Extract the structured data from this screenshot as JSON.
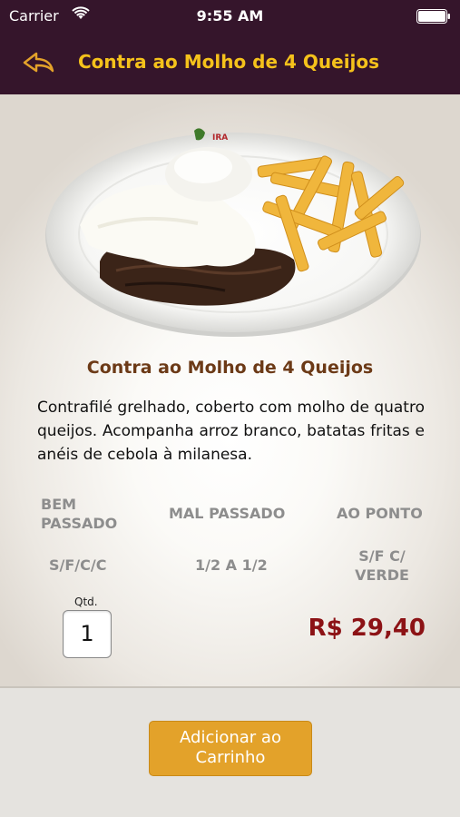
{
  "status_bar": {
    "carrier": "Carrier",
    "time": "9:55 AM"
  },
  "nav": {
    "back_icon": "back-arrow-icon",
    "title": "Contra ao Molho de  4 Queijos"
  },
  "product": {
    "image_icon": "dish-photo",
    "plate_logo": "IRA",
    "title": "Contra ao Molho de  4 Queijos",
    "description": "Contrafilé grelhado, coberto com molho de quatro queijos. Acompanha arroz branco, batatas fritas e anéis de cebola à milanesa."
  },
  "options": {
    "row1": [
      {
        "line1": "BEM",
        "line2": "PASSADO"
      },
      {
        "label": "MAL PASSADO"
      },
      {
        "label": "AO PONTO"
      }
    ],
    "row2": [
      {
        "label": "S/F/C/C"
      },
      {
        "label": "1/2 A 1/2"
      },
      {
        "line1": "S/F C/",
        "line2": "VERDE"
      }
    ]
  },
  "quantity": {
    "label": "Qtd.",
    "value": "1"
  },
  "price": "R$ 29,40",
  "actions": {
    "add_line1": "Adicionar ao",
    "add_line2": "Carrinho"
  },
  "colors": {
    "header_bg": "#35152b",
    "title_yellow": "#f5c21b",
    "dish_title_brown": "#6c3a17",
    "price_red": "#8c1215",
    "button_orange": "#e3a22a"
  }
}
